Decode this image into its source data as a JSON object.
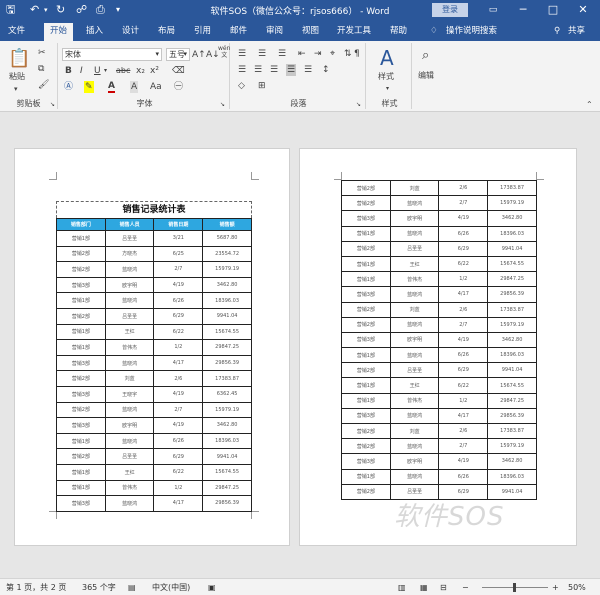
{
  "window": {
    "title": "软件SOS（微信公众号：rjsos666） - Word",
    "login": "登录",
    "controls": {
      "restore": "▭",
      "minimize": "─",
      "maximize": "□",
      "close": "✕"
    }
  },
  "tabs": [
    {
      "label": "文件",
      "active": false
    },
    {
      "label": "开始",
      "active": true
    },
    {
      "label": "插入",
      "active": false
    },
    {
      "label": "设计",
      "active": false
    },
    {
      "label": "布局",
      "active": false
    },
    {
      "label": "引用",
      "active": false
    },
    {
      "label": "邮件",
      "active": false
    },
    {
      "label": "审阅",
      "active": false
    },
    {
      "label": "视图",
      "active": false
    },
    {
      "label": "开发工具",
      "active": false
    },
    {
      "label": "帮助",
      "active": false
    }
  ],
  "tell_me": "操作说明搜索",
  "share": "共享",
  "ribbon": {
    "clipboard": {
      "paste": "粘贴",
      "label": "剪贴板"
    },
    "font": {
      "name": "宋体",
      "size": "五号",
      "label": "字体",
      "wen": "wén",
      "wen_char": "文",
      "a_char": "A"
    },
    "paragraph": {
      "label": "段落"
    },
    "styles": {
      "button": "样式",
      "label": "样式"
    },
    "editing": {
      "button": "编辑"
    }
  },
  "document": {
    "table_title": "销售记录统计表",
    "headers": [
      "销售部门",
      "销售人员",
      "销售日期",
      "销售额"
    ],
    "page1_rows": [
      [
        "营销1部",
        "吕圣圣",
        "3/21",
        "5687.80"
      ],
      [
        "营销2部",
        "方晓杰",
        "6/25",
        "23554.72"
      ],
      [
        "营销2部",
        "蓝晓鸿",
        "2/7",
        "15979.19"
      ],
      [
        "营销3部",
        "欧宇明",
        "4/19",
        "3462.80"
      ],
      [
        "营销1部",
        "蓝晓鸿",
        "6/26",
        "18396.03"
      ],
      [
        "营销2部",
        "吕圣圣",
        "6/29",
        "9941.04"
      ],
      [
        "营销1部",
        "王红",
        "6/22",
        "15674.55"
      ],
      [
        "营销1部",
        "曾伟杰",
        "1/2",
        "29847.25"
      ],
      [
        "营销3部",
        "蓝晓鸿",
        "4/17",
        "29856.39"
      ],
      [
        "营销2部",
        "刘蓝",
        "2/6",
        "17383.87"
      ],
      [
        "营销3部",
        "王晓宇",
        "4/19",
        "6362.45"
      ],
      [
        "营销2部",
        "蓝晓鸿",
        "2/7",
        "15979.19"
      ],
      [
        "营销3部",
        "欧宇明",
        "4/19",
        "3462.80"
      ],
      [
        "营销1部",
        "蓝晓鸿",
        "6/26",
        "18396.03"
      ],
      [
        "营销2部",
        "吕圣圣",
        "6/29",
        "9941.04"
      ],
      [
        "营销1部",
        "王红",
        "6/22",
        "15674.55"
      ],
      [
        "营销1部",
        "曾伟杰",
        "1/2",
        "29847.25"
      ],
      [
        "营销3部",
        "蓝晓鸿",
        "4/17",
        "29856.39"
      ]
    ],
    "page2_rows": [
      [
        "营销2部",
        "刘蓝",
        "2/6",
        "17383.87"
      ],
      [
        "营销2部",
        "蓝晓鸿",
        "2/7",
        "15979.19"
      ],
      [
        "营销3部",
        "欧宇明",
        "4/19",
        "3462.80"
      ],
      [
        "营销1部",
        "蓝晓鸿",
        "6/26",
        "18396.03"
      ],
      [
        "营销2部",
        "吕圣圣",
        "6/29",
        "9941.04"
      ],
      [
        "营销1部",
        "王红",
        "6/22",
        "15674.55"
      ],
      [
        "营销1部",
        "曾伟杰",
        "1/2",
        "29847.25"
      ],
      [
        "营销3部",
        "蓝晓鸿",
        "4/17",
        "29856.39"
      ],
      [
        "营销2部",
        "刘蓝",
        "2/6",
        "17383.87"
      ],
      [
        "营销2部",
        "蓝晓鸿",
        "2/7",
        "15979.19"
      ],
      [
        "营销3部",
        "欧宇明",
        "4/19",
        "3462.80"
      ],
      [
        "营销1部",
        "蓝晓鸿",
        "6/26",
        "18396.03"
      ],
      [
        "营销2部",
        "吕圣圣",
        "6/29",
        "9941.04"
      ],
      [
        "营销1部",
        "王红",
        "6/22",
        "15674.55"
      ],
      [
        "营销1部",
        "曾伟杰",
        "1/2",
        "29847.25"
      ],
      [
        "营销3部",
        "蓝晓鸿",
        "4/17",
        "29856.39"
      ],
      [
        "营销2部",
        "刘蓝",
        "2/6",
        "17383.87"
      ],
      [
        "营销2部",
        "蓝晓鸿",
        "2/7",
        "15979.19"
      ],
      [
        "营销3部",
        "欧宇明",
        "4/19",
        "3462.80"
      ],
      [
        "营销1部",
        "蓝晓鸿",
        "6/26",
        "18396.03"
      ],
      [
        "营销2部",
        "吕圣圣",
        "6/29",
        "9941.04"
      ]
    ],
    "watermark": "软件SOS"
  },
  "status": {
    "page": "第 1 页，共 2 页",
    "words": "365 个字",
    "lang": "中文(中国)",
    "zoom_minus": "−",
    "zoom_plus": "+",
    "zoom": "50%",
    "zoom_level": 0.5
  },
  "colors": {
    "brand": "#2b579a",
    "table_header": "#2ea7e0"
  }
}
